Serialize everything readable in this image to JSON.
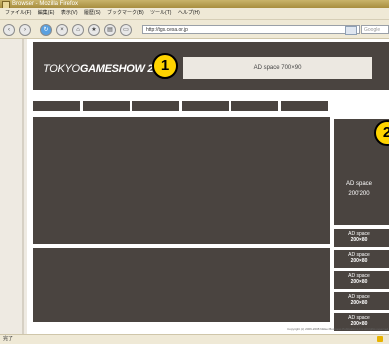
{
  "window": {
    "title": "Browser - Mozilla Firefox"
  },
  "menu": [
    "ファイル(F)",
    "編集(E)",
    "表示(V)",
    "履歴(S)",
    "ブックマーク(B)",
    "ツール(T)",
    "ヘルプ(H)"
  ],
  "address": {
    "url": "http://tgs.cesa.or.jp",
    "search_placeholder": "Google"
  },
  "nav_icons": [
    "back-icon",
    "forward-icon",
    "reload-icon",
    "stop-icon",
    "home-icon"
  ],
  "header": {
    "logo_prefix": "TOKYO",
    "logo_bold": "GAMESHOW",
    "logo_year": "2008",
    "marker": "1",
    "ad_text": "AD space  700×90"
  },
  "side": {
    "marker": "2",
    "big_ad_line1": "AD space",
    "big_ad_line2": "200'200",
    "small_ads": [
      {
        "l1": "AD space",
        "l2": "200×80"
      },
      {
        "l1": "AD space",
        "l2": "200×80"
      },
      {
        "l1": "AD space",
        "l2": "200×80"
      },
      {
        "l1": "AD space",
        "l2": "200×80"
      },
      {
        "l1": "AD space",
        "l2": "200×80"
      }
    ]
  },
  "footer": {
    "copyright": "Copyright (c) 2006-2008 Nikkei Business Publications,Inc.All rights reserved."
  },
  "status": {
    "text": "完了"
  },
  "colors": {
    "panel": "#4a4440",
    "marker_yellow": "#ffd400"
  }
}
